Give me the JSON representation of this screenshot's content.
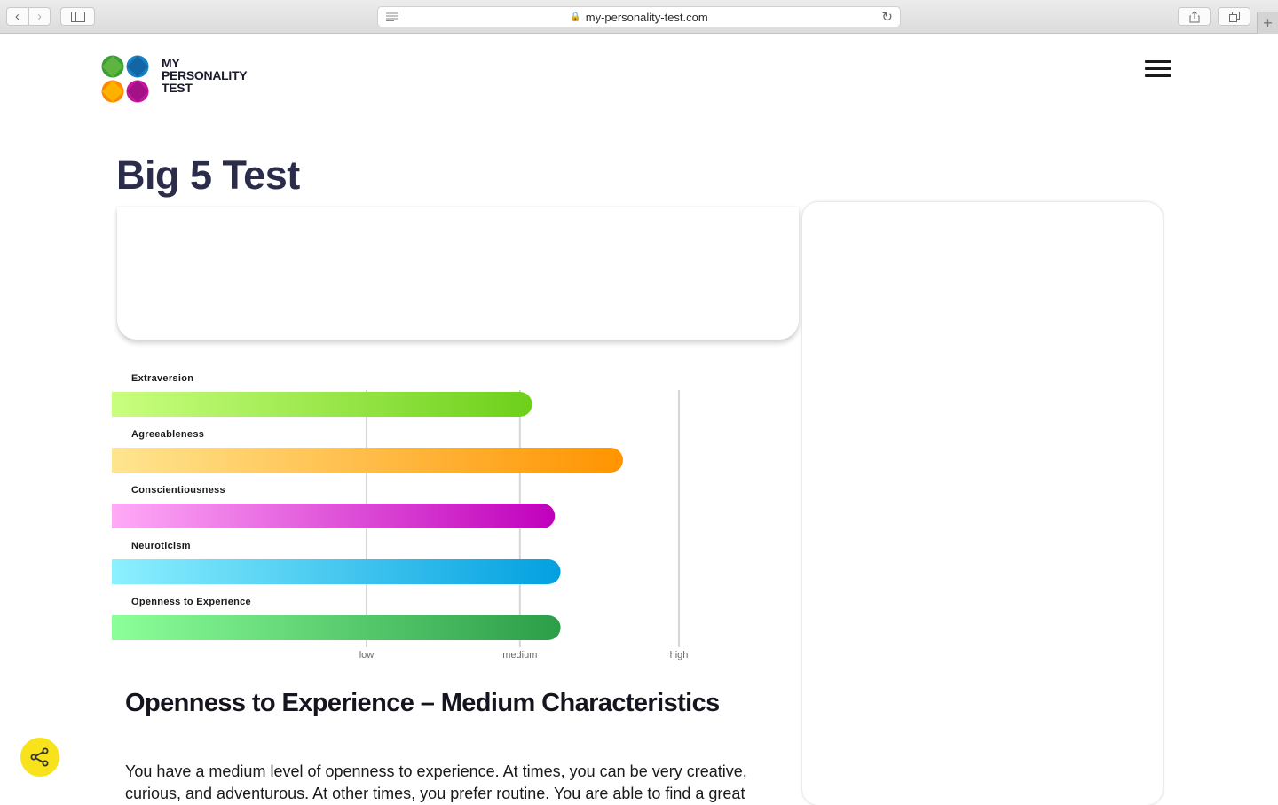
{
  "browser": {
    "url": "my-personality-test.com"
  },
  "site": {
    "logo_lines": [
      "MY",
      "PERSONALITY",
      "TEST"
    ]
  },
  "page": {
    "title": "Big 5 Test"
  },
  "chart_data": {
    "type": "bar",
    "orientation": "horizontal",
    "categories": [
      "Extraversion",
      "Agreeableness",
      "Conscientiousness",
      "Neuroticism",
      "Openness to Experience"
    ],
    "values": [
      0.74,
      0.9,
      0.78,
      0.79,
      0.79
    ],
    "value_scale": "fraction of chart range (low/medium/high guide positions at 0.45, 0.72, 1.0)",
    "x_ticks": [
      "low",
      "medium",
      "high"
    ],
    "grid": true,
    "colors": [
      [
        "#c9ff7f",
        "#6dd01a"
      ],
      [
        "#ffe590",
        "#ff9400"
      ],
      [
        "#ffaaf7",
        "#c000bc"
      ],
      [
        "#8cf0ff",
        "#02a0e0"
      ],
      [
        "#8cff9a",
        "#2c9d48"
      ]
    ]
  },
  "result": {
    "heading": "Openness to Experience – Medium Characteristics",
    "body": "You have a medium level of openness to experience. At times, you can be very creative, curious, and adventurous. At other times, you prefer routine. You are able to find a great"
  },
  "colors": {
    "title": "#2b2b4a",
    "share_fab": "#f7e21b"
  }
}
